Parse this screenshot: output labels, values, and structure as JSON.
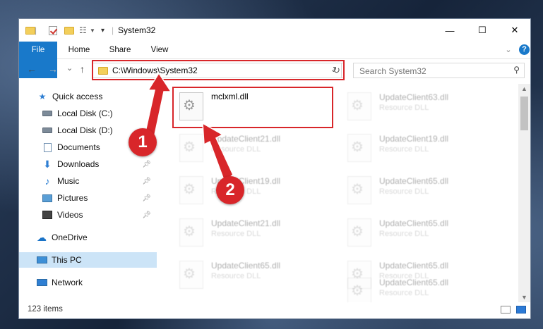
{
  "window": {
    "title": "System32",
    "controls": {
      "minimize": "—",
      "maximize": "☐",
      "close": "✕"
    }
  },
  "ribbon": {
    "tabs": [
      "File",
      "Home",
      "Share",
      "View"
    ],
    "expand_icon": "chevron-down-icon",
    "help_icon": "help-icon"
  },
  "navigation": {
    "back": "←",
    "forward": "→",
    "recent": "⌄",
    "up": "↑",
    "address_path": "C:\\Windows\\System32",
    "address_dropdown": "⌄",
    "refresh": "↻",
    "search_placeholder": "Search System32"
  },
  "sidebar": {
    "items": [
      {
        "label": "Quick access",
        "icon": "star-icon"
      },
      {
        "label": "Local Disk (C:)",
        "icon": "drive-icon"
      },
      {
        "label": "Local Disk (D:)",
        "icon": "drive-icon"
      },
      {
        "label": "Documents",
        "icon": "document-icon",
        "pinned": true
      },
      {
        "label": "Downloads",
        "icon": "download-icon",
        "pinned": true
      },
      {
        "label": "Music",
        "icon": "music-icon",
        "pinned": true
      },
      {
        "label": "Pictures",
        "icon": "picture-icon",
        "pinned": true
      },
      {
        "label": "Videos",
        "icon": "video-icon",
        "pinned": true
      },
      {
        "label": "OneDrive",
        "icon": "cloud-icon"
      },
      {
        "label": "This PC",
        "icon": "computer-icon",
        "selected": true
      },
      {
        "label": "Network",
        "icon": "network-icon"
      }
    ]
  },
  "files": {
    "highlighted": {
      "name": "mclxml.dll"
    },
    "left_column": [
      {
        "name": "UpdateClient21.dll",
        "type": "Resource DLL"
      },
      {
        "name": "UpdateClient19.dll",
        "type": "Resource DLL"
      },
      {
        "name": "UpdateClient21.dll",
        "type": "Resource DLL"
      },
      {
        "name": "UpdateClient65.dll",
        "type": "Resource DLL"
      }
    ],
    "right_column": [
      {
        "name": "UpdateClient63.dll",
        "type": "Resource DLL"
      },
      {
        "name": "UpdateClient19.dll",
        "type": "Resource DLL"
      },
      {
        "name": "UpdateClient65.dll",
        "type": "Resource DLL"
      },
      {
        "name": "UpdateClient65.dll",
        "type": "Resource DLL"
      },
      {
        "name": "UpdateClient65.dll",
        "type": "Resource DLL"
      },
      {
        "name": "UpdateClient65.dll",
        "type": "Resource DLL"
      }
    ]
  },
  "status": {
    "item_count": "123 items"
  },
  "annotations": {
    "step1": "1",
    "step2": "2",
    "color": "#d8262a"
  }
}
